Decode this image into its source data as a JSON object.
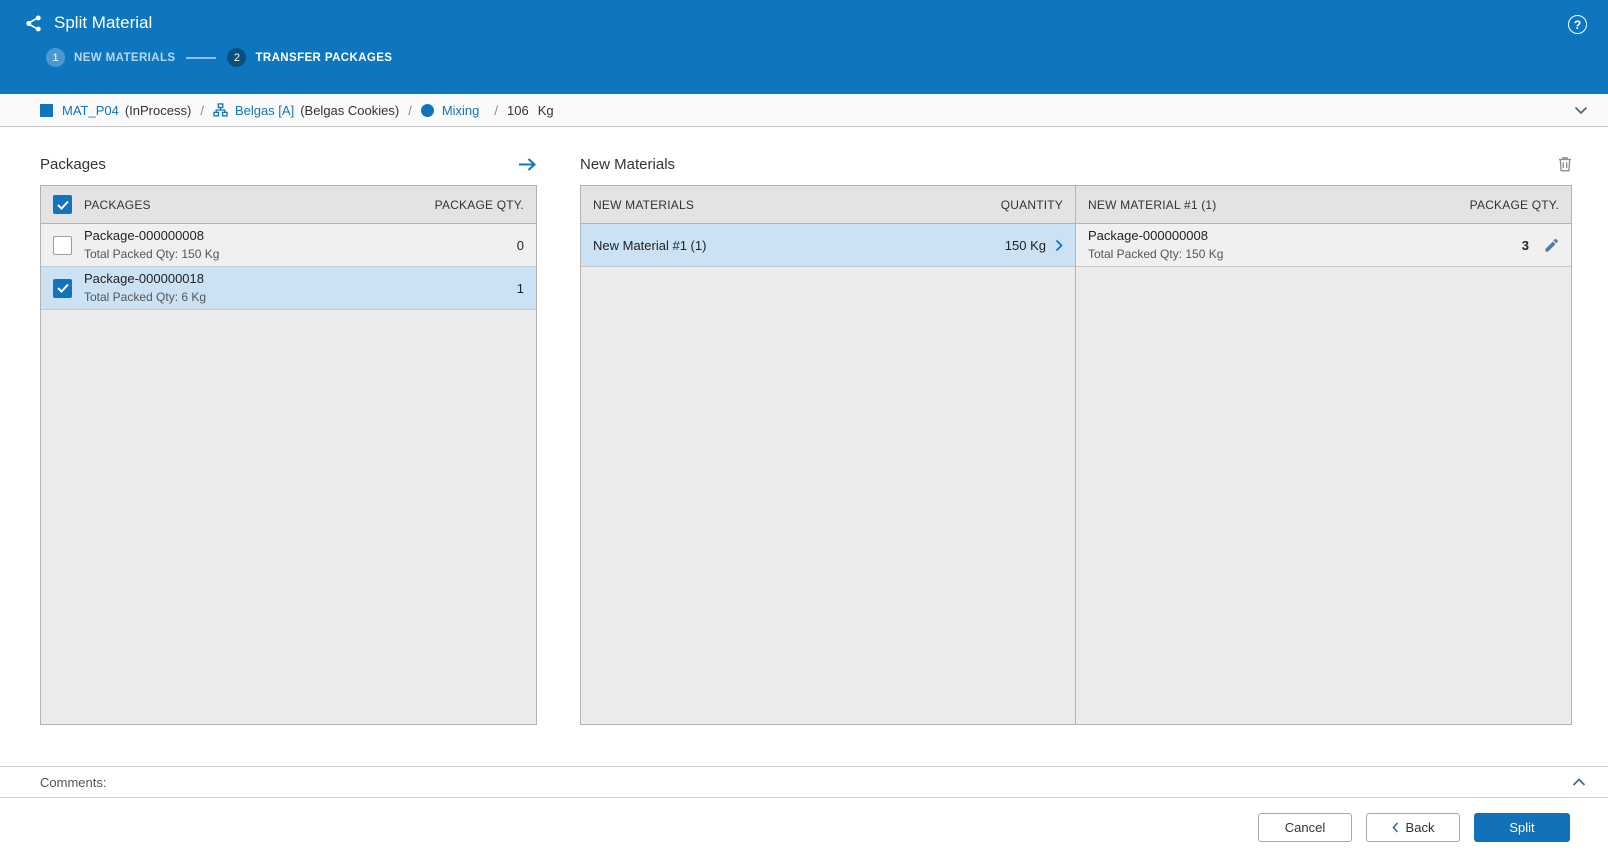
{
  "theme": {
    "header_blue": "#0d76bf",
    "link_blue": "#1274bc",
    "selection_blue": "#cbe2f5",
    "primary_button_blue": "#1172ba"
  },
  "header": {
    "title": "Split Material",
    "help_label": "?",
    "steps": [
      {
        "number": "1",
        "label": "NEW MATERIALS"
      },
      {
        "number": "2",
        "label": "TRANSFER PACKAGES"
      }
    ]
  },
  "breadcrumb": {
    "material_name": "MAT_P04",
    "material_state": "(InProcess)",
    "separator": "/",
    "flow_name": "Belgas [A]",
    "flow_description": "(Belgas Cookies)",
    "step_name": "Mixing",
    "quantity_value": "106",
    "quantity_unit": "Kg"
  },
  "packages": {
    "title": "Packages",
    "columns": {
      "packages": "PACKAGES",
      "qty": "PACKAGE QTY."
    },
    "select_all_checked": true,
    "rows": [
      {
        "name": "Package-000000008",
        "detail": "Total Packed Qty: 150 Kg",
        "qty": "0",
        "checked": false,
        "selected": false
      },
      {
        "name": "Package-000000018",
        "detail": "Total Packed Qty: 6 Kg",
        "qty": "1",
        "checked": true,
        "selected": true
      }
    ]
  },
  "new_materials": {
    "title": "New Materials",
    "materials_table": {
      "columns": {
        "name": "NEW MATERIALS",
        "qty": "QUANTITY"
      },
      "rows": [
        {
          "name": "New Material #1 (1)",
          "qty": "150 Kg",
          "selected": true
        }
      ]
    },
    "packages_table": {
      "columns": {
        "name": "NEW MATERIAL #1 (1)",
        "qty": "PACKAGE QTY."
      },
      "rows": [
        {
          "name": "Package-000000008",
          "detail": "Total Packed Qty: 150 Kg",
          "qty": "3"
        }
      ]
    }
  },
  "comments": {
    "label": "Comments:"
  },
  "footer": {
    "cancel_label": "Cancel",
    "back_label": "Back",
    "split_label": "Split"
  }
}
